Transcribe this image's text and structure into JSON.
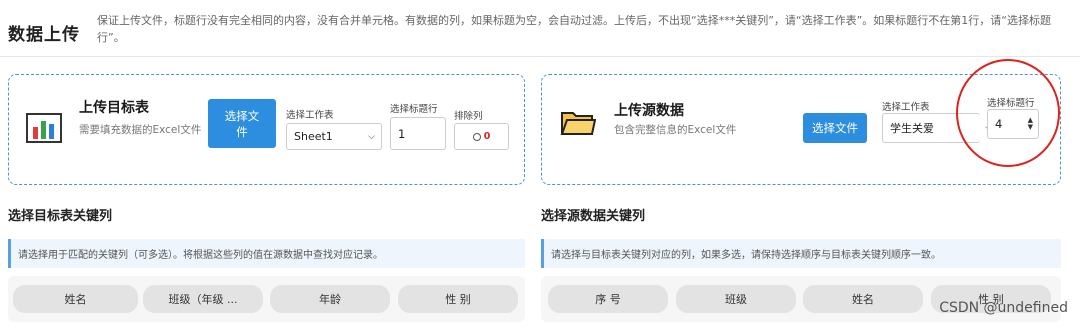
{
  "header": {
    "title": "数据上传",
    "notice": "保证上传文件，标题行没有完全相同的内容，没有合并单元格。有数据的列，如果标题为空，会自动过滤。上传后，不出现“选择***关键列”，请“选择工作表”。如果标题行不在第1行，请“选择标题行”。"
  },
  "target_card": {
    "title": "上传目标表",
    "desc": "需要填充数据的Excel文件",
    "choose_file_label": "选择文件",
    "sheet_label": "选择工作表",
    "sheet_value": "Sheet1",
    "title_row_label": "选择标题行",
    "title_row_value": "1",
    "exclude_label": "排除列",
    "exclude_count": "0"
  },
  "source_card": {
    "title": "上传源数据",
    "desc": "包含完整信息的Excel文件",
    "choose_file_label": "选择文件",
    "sheet_label": "选择工作表",
    "sheet_value": "学生关爱",
    "title_row_label": "选择标题行",
    "title_row_value": "4"
  },
  "target_keys": {
    "title": "选择目标表关键列",
    "hint": "请选择用于匹配的关键列（可多选）。将根据这些列的值在源数据中查找对应记录。",
    "columns": [
      "姓名",
      "班级（年级 ...",
      "年龄",
      "性 别"
    ]
  },
  "source_keys": {
    "title": "选择源数据关键列",
    "hint": "请选择与目标表关键列对应的列，如果多选，请保持选择顺序与目标表关键列顺序一致。",
    "columns": [
      "序 号",
      "班级",
      "姓名",
      "性 别"
    ]
  },
  "watermark": "CSDN @undefined",
  "colors": {
    "accent": "#2d8ee0",
    "highlight": "#e0201a",
    "border_dashed": "#4a94d6"
  }
}
